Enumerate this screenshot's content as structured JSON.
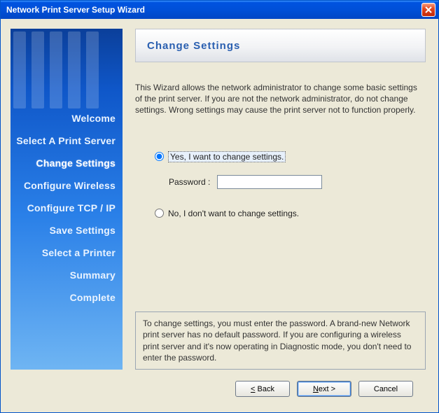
{
  "window": {
    "title": "Network Print Server Setup Wizard"
  },
  "sidebar": {
    "items": [
      {
        "label": "Welcome"
      },
      {
        "label": "Select A Print Server"
      },
      {
        "label": "Change Settings"
      },
      {
        "label": "Configure Wireless"
      },
      {
        "label": "Configure TCP / IP"
      },
      {
        "label": "Save Settings"
      },
      {
        "label": "Select a Printer"
      },
      {
        "label": "Summary"
      },
      {
        "label": "Complete"
      }
    ],
    "active_index": 2
  },
  "main": {
    "heading": "Change Settings",
    "description": "This Wizard allows the network administrator to change some basic settings of the print server. If you are not the network administrator, do not change settings. Wrong settings may cause the print server not to function properly.",
    "option_yes": "Yes, I want to change settings.",
    "option_no": "No, I don't want to change settings.",
    "password_label": "Password :",
    "password_value": "",
    "note": "To change settings, you must enter the password. A brand-new Network print server has no default password. If you are configuring a wireless print server and it's now operating in Diagnostic mode, you don't need to enter the password."
  },
  "buttons": {
    "back": "< Back",
    "next": "Next >",
    "cancel": "Cancel"
  }
}
